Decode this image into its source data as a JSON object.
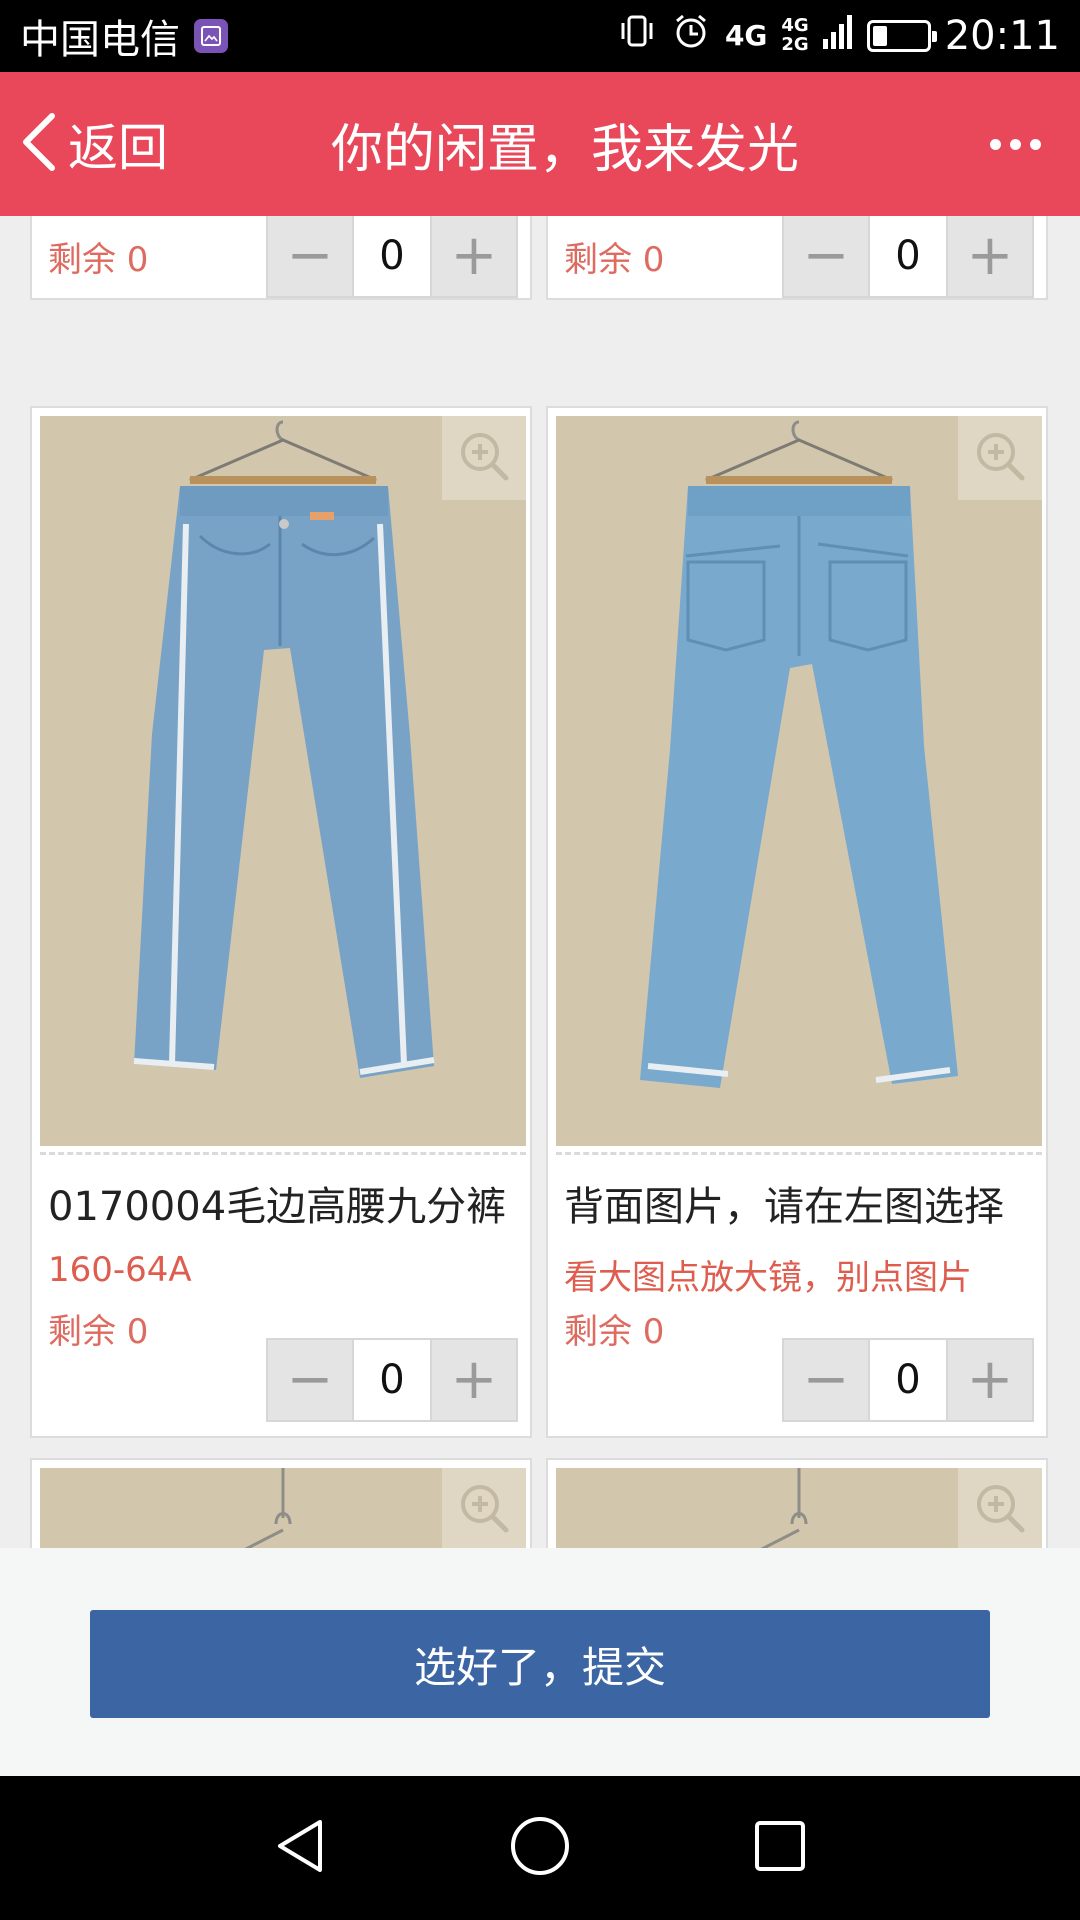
{
  "status_bar": {
    "carrier": "中国电信",
    "net_main": "4G",
    "net_top": "4G",
    "net_bottom": "2G",
    "time": "20:11"
  },
  "header": {
    "back_label": "返回",
    "title": "你的闲置，我来发光"
  },
  "partial_top": {
    "left": {
      "stock_label": "剩余 0",
      "quantity": "0"
    },
    "right": {
      "stock_label": "剩余 0",
      "quantity": "0"
    }
  },
  "products": [
    {
      "title": "0170004毛边高腰九分裤",
      "subtitle": "160-64A",
      "stock_label": "剩余 0",
      "quantity": "0"
    },
    {
      "title": "背面图片，请在左图选择",
      "subtitle": "看大图点放大镜，别点图片",
      "stock_label": "剩余 0",
      "quantity": "0"
    }
  ],
  "stepper": {
    "minus": "−",
    "plus": "+"
  },
  "footer": {
    "submit_label": "选好了，提交"
  },
  "icons": {
    "back": "chevron-left-icon",
    "more": "more-dots-icon",
    "zoom": "zoom-in-icon",
    "vibrate": "vibrate-icon",
    "alarm": "alarm-icon",
    "battery": "battery-icon",
    "nav_back": "nav-back-icon",
    "nav_home": "nav-home-icon",
    "nav_recent": "nav-recent-icon"
  },
  "colors": {
    "header_bg": "#e8485a",
    "price_red": "#de5d4e",
    "submit_blue": "#3c66a3"
  }
}
